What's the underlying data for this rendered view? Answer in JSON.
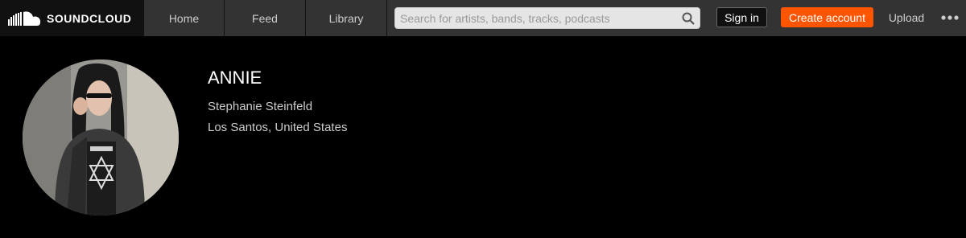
{
  "header": {
    "logo_text": "SOUNDCLOUD",
    "nav": [
      {
        "label": "Home"
      },
      {
        "label": "Feed"
      },
      {
        "label": "Library"
      }
    ],
    "search": {
      "placeholder": "Search for artists, bands, tracks, podcasts",
      "value": ""
    },
    "sign_in_label": "Sign in",
    "create_account_label": "Create account",
    "upload_label": "Upload",
    "more_icon": "more-icon"
  },
  "profile": {
    "username": "ANNIE",
    "full_name": "Stephanie Steinfeld",
    "location": "Los Santos, United States",
    "avatar_icon": "avatar-photo"
  },
  "colors": {
    "accent": "#ff5500",
    "header_bg": "#333333",
    "page_bg": "#000000"
  }
}
